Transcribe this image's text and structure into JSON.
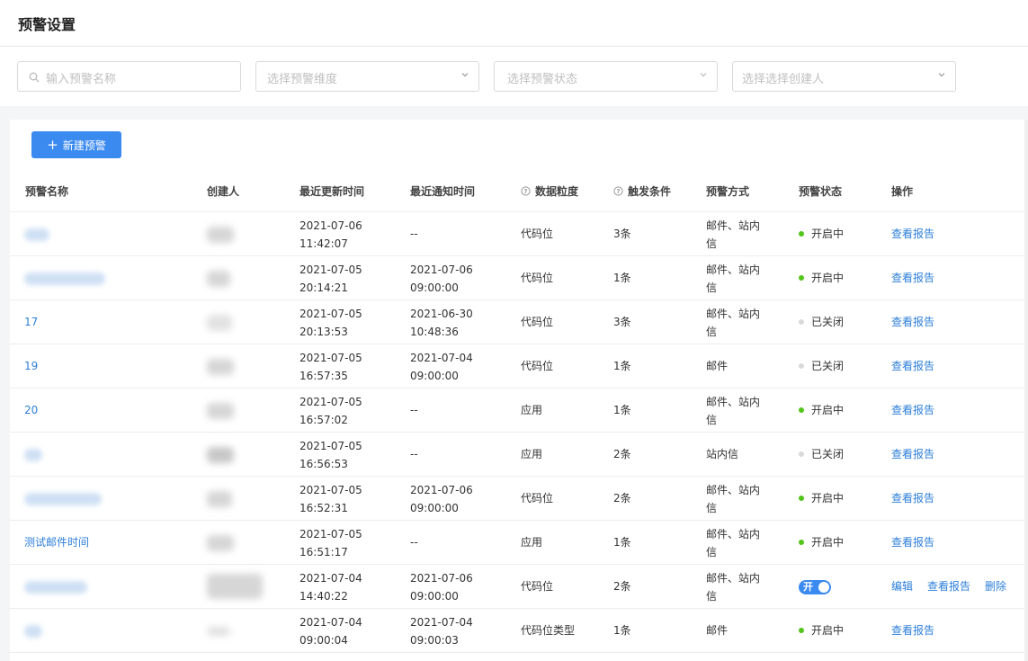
{
  "page": {
    "title": "预警设置"
  },
  "filters": {
    "search_placeholder": "输入预警名称",
    "dimension_placeholder": "选择预警维度",
    "status_placeholder": "选择预警状态",
    "creator_placeholder": "选择选择创建人"
  },
  "toolbar": {
    "new_button": "新建预警"
  },
  "table": {
    "headers": {
      "name": "预警名称",
      "creator": "创建人",
      "updated": "最近更新时间",
      "notified": "最近通知时间",
      "granularity": "数据粒度",
      "condition": "触发条件",
      "method": "预警方式",
      "status": "预警状态",
      "actions": "操作"
    },
    "rows": [
      {
        "name": "",
        "updated_date": "2021-07-06",
        "updated_time": "11:42:07",
        "notified_date": "--",
        "notified_time": "",
        "granularity": "代码位",
        "condition": "3条",
        "method_1": "邮件、站内",
        "method_2": "信",
        "status": "开启中",
        "status_color": "#52c41a",
        "action": "查看报告"
      },
      {
        "name": "",
        "updated_date": "2021-07-05",
        "updated_time": "20:14:21",
        "notified_date": "2021-07-06",
        "notified_time": "09:00:00",
        "granularity": "代码位",
        "condition": "1条",
        "method_1": "邮件、站内",
        "method_2": "信",
        "status": "开启中",
        "status_color": "#52c41a",
        "action": "查看报告"
      },
      {
        "name": "17",
        "updated_date": "2021-07-05",
        "updated_time": "20:13:53",
        "notified_date": "2021-06-30",
        "notified_time": "10:48:36",
        "granularity": "代码位",
        "condition": "3条",
        "method_1": "邮件、站内",
        "method_2": "信",
        "status": "已关闭",
        "status_color": "#d9d9d9",
        "action": "查看报告"
      },
      {
        "name": "19",
        "updated_date": "2021-07-05",
        "updated_time": "16:57:35",
        "notified_date": "2021-07-04",
        "notified_time": "09:00:00",
        "granularity": "代码位",
        "condition": "1条",
        "method_1": "邮件",
        "method_2": "",
        "status": "已关闭",
        "status_color": "#d9d9d9",
        "action": "查看报告"
      },
      {
        "name": "20",
        "updated_date": "2021-07-05",
        "updated_time": "16:57:02",
        "notified_date": "--",
        "notified_time": "",
        "granularity": "应用",
        "condition": "1条",
        "method_1": "邮件、站内",
        "method_2": "信",
        "status": "开启中",
        "status_color": "#52c41a",
        "action": "查看报告"
      },
      {
        "name": "",
        "updated_date": "2021-07-05",
        "updated_time": "16:56:53",
        "notified_date": "--",
        "notified_time": "",
        "granularity": "应用",
        "condition": "2条",
        "method_1": "站内信",
        "method_2": "",
        "status": "已关闭",
        "status_color": "#d9d9d9",
        "action": "查看报告"
      },
      {
        "name": "",
        "updated_date": "2021-07-05",
        "updated_time": "16:52:31",
        "notified_date": "2021-07-06",
        "notified_time": "09:00:00",
        "granularity": "代码位",
        "condition": "2条",
        "method_1": "邮件、站内",
        "method_2": "信",
        "status": "开启中",
        "status_color": "#52c41a",
        "action": "查看报告"
      },
      {
        "name": "测试邮件时间",
        "updated_date": "2021-07-05",
        "updated_time": "16:51:17",
        "notified_date": "--",
        "notified_time": "",
        "granularity": "应用",
        "condition": "1条",
        "method_1": "邮件、站内",
        "method_2": "信",
        "status": "开启中",
        "status_color": "#52c41a",
        "action": "查看报告"
      },
      {
        "name": "",
        "updated_date": "2021-07-04",
        "updated_time": "14:40:22",
        "notified_date": "2021-07-06",
        "notified_time": "09:00:00",
        "granularity": "代码位",
        "condition": "2条",
        "method_1": "邮件、站内",
        "method_2": "信",
        "toggle_label": "开",
        "edit": "编辑",
        "action": "查看报告",
        "delete": "删除"
      },
      {
        "name": "",
        "updated_date": "2021-07-04",
        "updated_time": "09:00:04",
        "notified_date": "2021-07-04",
        "notified_time": "09:00:03",
        "granularity": "代码位类型",
        "condition": "1条",
        "method_1": "邮件",
        "method_2": "",
        "status": "开启中",
        "status_color": "#52c41a",
        "action": "查看报告"
      }
    ]
  },
  "icons": {
    "search": "search-icon",
    "chevron": "chevron-down-icon",
    "help": "question-circle-icon",
    "plus": "plus-icon"
  },
  "colors": {
    "primary": "#3b8af0",
    "link": "#2e7fd9",
    "on": "#52c41a",
    "off": "#d9d9d9"
  }
}
